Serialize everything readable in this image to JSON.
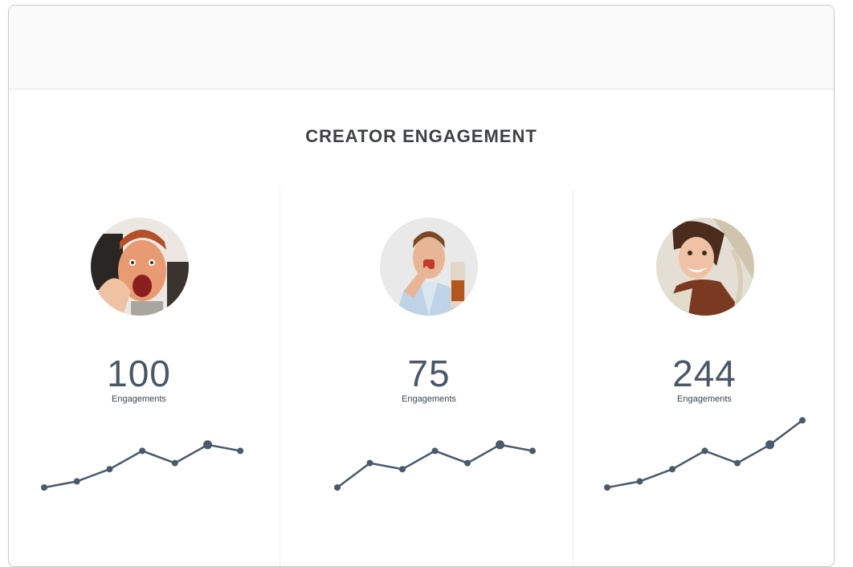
{
  "section": {
    "title": "CREATOR ENGAGEMENT"
  },
  "theme": {
    "line_color": "#4a5a6a",
    "divider_color": "#ececec"
  },
  "creators": [
    {
      "avatar_icon": "excited-man-thumbs-up-photo",
      "value": "100",
      "label": "Engagements",
      "trend": [
        1,
        2,
        4,
        7,
        5,
        8,
        7
      ]
    },
    {
      "avatar_icon": "man-drinking-photo",
      "value": "75",
      "label": "Engagements",
      "trend": [
        1,
        5,
        4,
        7,
        5,
        8,
        7
      ]
    },
    {
      "avatar_icon": "smiling-woman-hat-photo",
      "value": "244",
      "label": "Engagements",
      "trend": [
        1,
        2,
        4,
        7,
        5,
        8,
        12
      ]
    }
  ]
}
